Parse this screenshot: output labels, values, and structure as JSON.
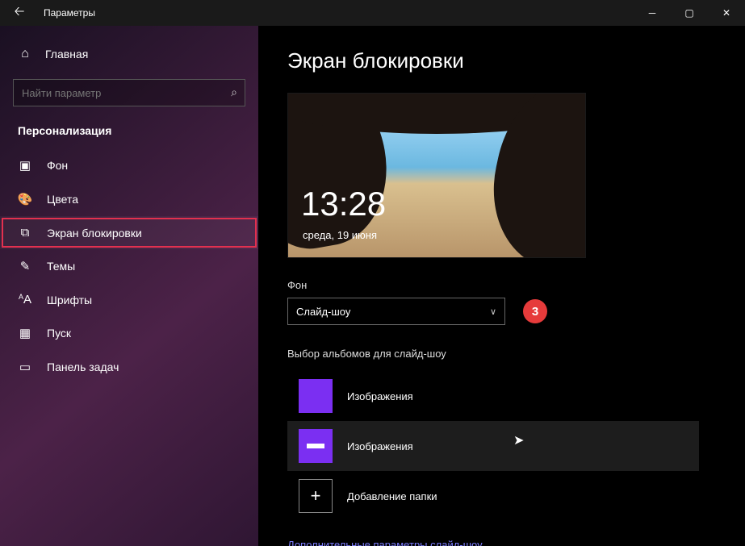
{
  "window": {
    "title": "Параметры"
  },
  "home": {
    "label": "Главная"
  },
  "search": {
    "placeholder": "Найти параметр"
  },
  "sectionTitle": "Персонализация",
  "nav": {
    "items": [
      {
        "label": "Фон"
      },
      {
        "label": "Цвета"
      },
      {
        "label": "Экран блокировки"
      },
      {
        "label": "Темы"
      },
      {
        "label": "Шрифты"
      },
      {
        "label": "Пуск"
      },
      {
        "label": "Панель задач"
      }
    ]
  },
  "page": {
    "title": "Экран блокировки",
    "preview": {
      "time": "13:28",
      "date": "среда, 19 июня"
    },
    "backgroundLabel": "Фон",
    "backgroundValue": "Слайд-шоу",
    "badge": "3",
    "albumsLabel": "Выбор альбомов для слайд-шоу",
    "albums": [
      {
        "label": "Изображения"
      },
      {
        "label": "Изображения"
      }
    ],
    "addFolder": "Добавление папки",
    "advancedLink": "Дополнительные параметры слайд-шоу"
  }
}
